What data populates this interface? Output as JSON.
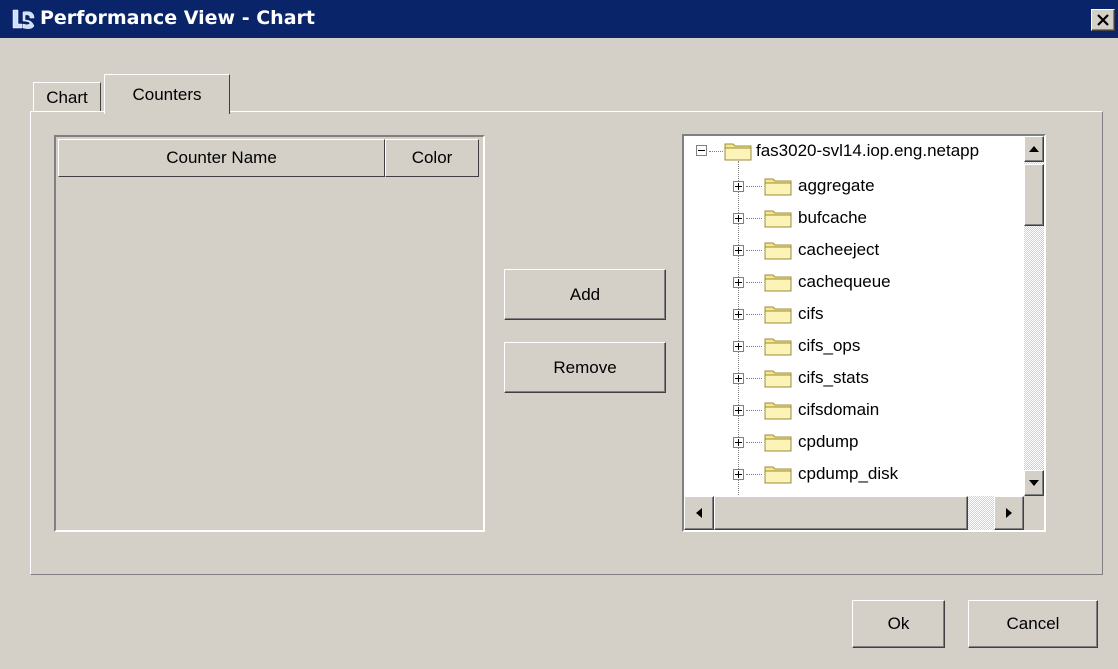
{
  "window": {
    "title": "Performance View - Chart",
    "app_icon": "netapp-logo-icon",
    "close_icon": "close-icon",
    "title_bar_color": "#0a246a"
  },
  "tabs": [
    {
      "label": "Chart",
      "selected": false
    },
    {
      "label": "Counters",
      "selected": true
    }
  ],
  "counter_table": {
    "columns": [
      "Counter Name",
      "Color"
    ],
    "rows": []
  },
  "actions": {
    "add_label": "Add",
    "remove_label": "Remove"
  },
  "tree": {
    "root": "fas3020-svl14.iop.eng.netapp",
    "children": [
      "aggregate",
      "bufcache",
      "cacheeject",
      "cachequeue",
      "cifs",
      "cifs_ops",
      "cifs_stats",
      "cifsdomain",
      "cpdump",
      "cpdump_disk"
    ],
    "folder_icon": "folder-icon",
    "expand_icon": "expand-plus-icon",
    "collapse_icon": "collapse-minus-icon"
  },
  "footer": {
    "ok_label": "Ok",
    "cancel_label": "Cancel"
  }
}
